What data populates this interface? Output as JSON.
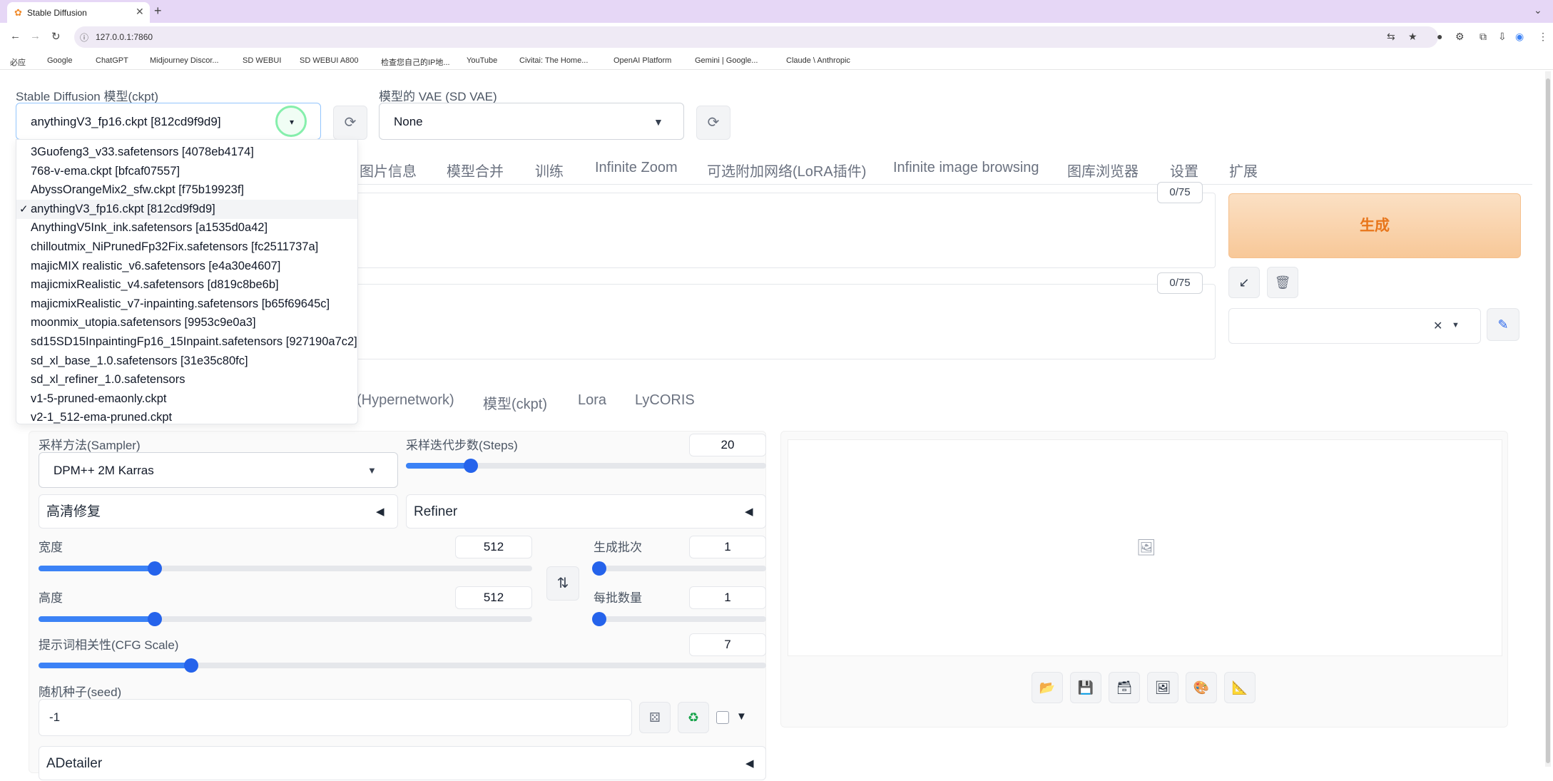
{
  "browser": {
    "tab_title": "Stable Diffusion",
    "tab_close": "✕",
    "new_tab": "+",
    "tab_menu": "⌄",
    "url": "127.0.0.1:7860",
    "bookmarks": [
      "必应",
      "Google",
      "ChatGPT",
      "Midjourney Discor...",
      "SD WEBUI",
      "SD WEBUI A800",
      "检查您自己的IP地...",
      "YouTube",
      "Civitai: The Home...",
      "OpenAI Platform",
      "Gemini | Google...",
      "Claude \\ Anthropic"
    ]
  },
  "top": {
    "ckpt_label": "Stable Diffusion 模型(ckpt)",
    "ckpt_value": "anythingV3_fp16.ckpt [812cd9f9d9]",
    "vae_label": "模型的 VAE (SD VAE)",
    "vae_value": "None"
  },
  "nav_tabs": [
    "图片信息",
    "模型合并",
    "训练",
    "Infinite Zoom",
    "可选附加网络(LoRA插件)",
    "Infinite image browsing",
    "图库浏览器",
    "设置",
    "扩展"
  ],
  "prompt": {
    "pos_counter": "0/75",
    "neg_counter": "0/75",
    "generate_label": "生成"
  },
  "sub_tabs": [
    "(Hypernetwork)",
    "模型(ckpt)",
    "Lora",
    "LyCORIS"
  ],
  "dropdown": {
    "items": [
      "3Guofeng3_v33.safetensors [4078eb4174]",
      "768-v-ema.ckpt [bfcaf07557]",
      "AbyssOrangeMix2_sfw.ckpt [f75b19923f]",
      "anythingV3_fp16.ckpt [812cd9f9d9]",
      "AnythingV5Ink_ink.safetensors [a1535d0a42]",
      "chilloutmix_NiPrunedFp32Fix.safetensors [fc2511737a]",
      "majicMIX realistic_v6.safetensors [e4a30e4607]",
      "majicmixRealistic_v4.safetensors [d819c8be6b]",
      "majicmixRealistic_v7-inpainting.safetensors [b65f69645c]",
      "moonmix_utopia.safetensors [9953c9e0a3]",
      "sd15SD15InpaintingFp16_15Inpaint.safetensors [927190a7c2]",
      "sd_xl_base_1.0.safetensors [31e35c80fc]",
      "sd_xl_refiner_1.0.safetensors",
      "v1-5-pruned-emaonly.ckpt",
      "v2-1_512-ema-pruned.ckpt"
    ],
    "selected_index": 3,
    "check": "✓"
  },
  "params": {
    "sampler_label": "采样方法(Sampler)",
    "sampler_value": "DPM++ 2M Karras",
    "steps_label": "采样迭代步数(Steps)",
    "steps_value": "20",
    "steps_fraction": 0.18,
    "hires_label": "高清修复",
    "refiner_label": "Refiner",
    "width_label": "宽度",
    "width_value": "512",
    "width_fraction": 0.235,
    "height_label": "高度",
    "height_value": "512",
    "height_fraction": 0.235,
    "batch_count_label": "生成批次",
    "batch_count_value": "1",
    "batch_count_fraction": 0.0,
    "batch_size_label": "每批数量",
    "batch_size_value": "1",
    "batch_size_fraction": 0.0,
    "cfg_label": "提示词相关性(CFG Scale)",
    "cfg_value": "7",
    "cfg_fraction": 0.21,
    "seed_label": "随机种子(seed)",
    "seed_value": "-1",
    "adetailer_label": "ADetailer"
  },
  "colors": {
    "accent": "#3b82f6",
    "generate_bg": "#fbd9b8",
    "generate_text": "#e8761b",
    "tabbar": "#e6d7f6"
  }
}
